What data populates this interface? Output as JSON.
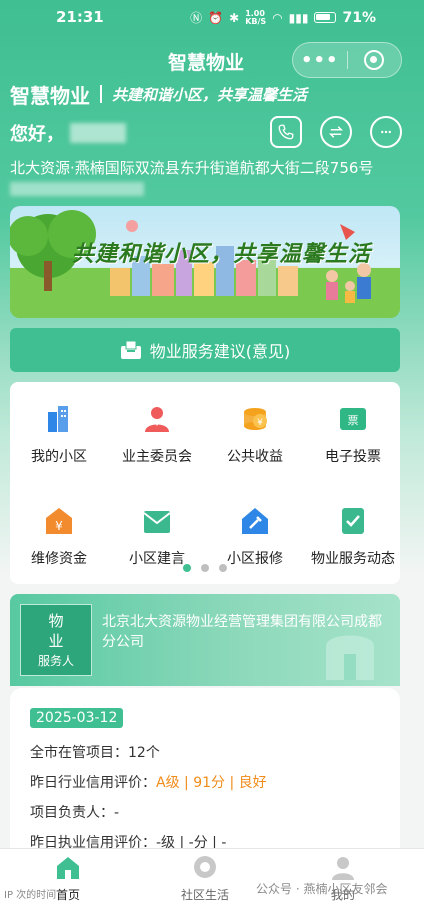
{
  "status": {
    "time": "21:31",
    "net_speed": "1.00\nKB/S",
    "battery": "71%"
  },
  "nav": {
    "title": "智慧物业",
    "more": "•••"
  },
  "brand": {
    "name": "智慧物业",
    "slogan": "共建和谐小区，共享温馨生活"
  },
  "user": {
    "greeting": "您好，",
    "address": "北大资源·燕楠国际双流县东升街道航都大街二段756号"
  },
  "banner": {
    "text": "共建和谐小区，共享温馨生活"
  },
  "suggest_button": "物业服务建议(意见)",
  "grid": [
    {
      "label": "我的小区",
      "icon": "building-icon",
      "color": "#2e86e6"
    },
    {
      "label": "业主委员会",
      "icon": "committee-icon",
      "color": "#ef5b5b"
    },
    {
      "label": "公共收益",
      "icon": "coins-icon",
      "color": "#f4a21d"
    },
    {
      "label": "电子投票",
      "icon": "ticket-icon",
      "color": "#2fb886"
    },
    {
      "label": "维修资金",
      "icon": "yuan-house-icon",
      "color": "#f28a2e"
    },
    {
      "label": "小区建言",
      "icon": "mail-icon",
      "color": "#3cb88e"
    },
    {
      "label": "小区报修",
      "icon": "repair-icon",
      "color": "#2e86e6"
    },
    {
      "label": "物业服务动态",
      "icon": "doc-check-icon",
      "color": "#3cb88e"
    }
  ],
  "service": {
    "tag_line1": "物",
    "tag_line2": "业",
    "tag_line3": "服务人",
    "company": "北京北大资源物业经营管理集团有限公司成都分公司"
  },
  "info": {
    "date": "2025-03-12",
    "projects": "全市在管项目：12个",
    "rating_label": "昨日行业信用评价：",
    "rating_value": "A级 | 91分 | 良好",
    "manager": "项目负责人：-",
    "exec_rating": "昨日执业信用评价：-级 | -分 | -"
  },
  "tabbar": [
    {
      "label": "首页",
      "icon": "home-icon"
    },
    {
      "label": "社区生活",
      "icon": "chat-icon"
    },
    {
      "label": "我的",
      "icon": "person-icon"
    }
  ],
  "watermark": {
    "left": "IP 次的时间",
    "right": "公众号 · 燕楠小区友邻会"
  },
  "colors": {
    "primary": "#3fbf92",
    "accent": "#f08c1a"
  }
}
